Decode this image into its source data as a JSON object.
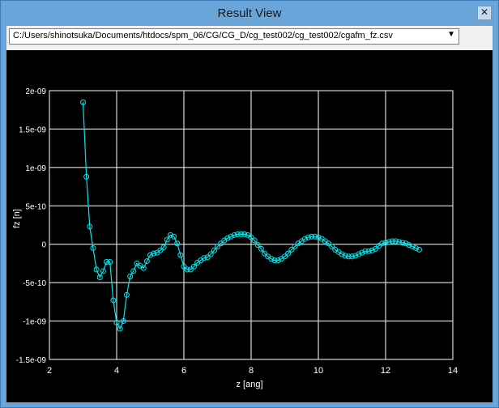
{
  "window": {
    "title": "Result View",
    "close_glyph": "✕"
  },
  "file_select": {
    "value": "C:/Users/shinotsuka/Documents/htdocs/spm_06/CG/CG_D/cg_test002/cg_test002/cgafm_fz.csv",
    "arrow_icon": "chevron-down-icon"
  },
  "colors": {
    "plot_bg": "#000000",
    "grid": "#ffffff",
    "series": "#00e5ee",
    "text": "#ffffff"
  },
  "chart_data": {
    "type": "line",
    "xlabel": "z [ang]",
    "ylabel": "fz [n]",
    "xlim": [
      2,
      14
    ],
    "ylim": [
      -1.5e-09,
      2e-09
    ],
    "xticks": [
      2,
      4,
      6,
      8,
      10,
      12,
      14
    ],
    "xtick_labels": [
      "2",
      "4",
      "6",
      "8",
      "10",
      "12",
      "14"
    ],
    "yticks": [
      2e-09,
      1.5e-09,
      1e-09,
      5e-10,
      0,
      -5e-10,
      -1e-09,
      -1.5e-09
    ],
    "ytick_labels": [
      "2e-09",
      "1.5e-09",
      "1e-09",
      "5e-10",
      "0",
      "-5e-10",
      "-1e-09",
      "-1.5e-09"
    ],
    "grid": true,
    "markers": "circle",
    "series": [
      {
        "x": [
          3.0,
          3.1,
          3.2,
          3.3,
          3.4,
          3.5,
          3.6,
          3.7,
          3.8,
          3.9,
          4.0,
          4.1,
          4.2,
          4.3,
          4.4,
          4.5,
          4.6,
          4.7,
          4.8,
          4.9,
          5.0,
          5.1,
          5.2,
          5.3,
          5.4,
          5.5,
          5.6,
          5.7,
          5.8,
          5.9,
          6.0,
          6.1,
          6.2,
          6.3,
          6.4,
          6.5,
          6.6,
          6.7,
          6.8,
          6.9,
          7.0,
          7.1,
          7.2,
          7.3,
          7.4,
          7.5,
          7.6,
          7.7,
          7.8,
          7.9,
          8.0,
          8.1,
          8.2,
          8.3,
          8.4,
          8.5,
          8.6,
          8.7,
          8.8,
          8.9,
          9.0,
          9.1,
          9.2,
          9.3,
          9.4,
          9.5,
          9.6,
          9.7,
          9.8,
          9.9,
          10.0,
          10.1,
          10.2,
          10.3,
          10.4,
          10.5,
          10.6,
          10.7,
          10.8,
          10.9,
          11.0,
          11.1,
          11.2,
          11.3,
          11.4,
          11.5,
          11.6,
          11.7,
          11.8,
          11.9,
          12.0,
          12.1,
          12.2,
          12.3,
          12.4,
          12.5,
          12.6,
          12.7,
          12.8,
          12.9,
          13.0
        ],
        "y": [
          1.85e-09,
          8.8e-10,
          2.3e-10,
          -5e-11,
          -3.3e-10,
          -4.3e-10,
          -3.5e-10,
          -2.3e-10,
          -2.3e-10,
          -7.3e-10,
          -1.02e-09,
          -1.1e-09,
          -1e-09,
          -6.6e-10,
          -4.2e-10,
          -3.5e-10,
          -2.5e-10,
          -2.8e-10,
          -3.1e-10,
          -2.2e-10,
          -1.4e-10,
          -1.2e-10,
          -1.1e-10,
          -8e-11,
          -4e-11,
          6e-11,
          1.2e-10,
          1e-10,
          1e-11,
          -1.4e-10,
          -2.9e-10,
          -3.3e-10,
          -3.3e-10,
          -2.9e-10,
          -2.4e-10,
          -2.1e-10,
          -1.8e-10,
          -1.7e-10,
          -1.3e-10,
          -8e-11,
          -3e-11,
          1e-11,
          5e-11,
          8e-11,
          1e-10,
          1.2e-10,
          1.3e-10,
          1.3e-10,
          1.3e-10,
          1.2e-10,
          9e-11,
          5e-11,
          -1e-11,
          -6e-11,
          -1.2e-10,
          -1.6e-10,
          -1.9e-10,
          -2.1e-10,
          -2.1e-10,
          -1.9e-10,
          -1.6e-10,
          -1.2e-10,
          -7e-11,
          -3e-11,
          1e-11,
          4e-11,
          7e-11,
          9e-11,
          1e-10,
          1e-10,
          9e-11,
          7e-11,
          4e-11,
          1e-11,
          -3e-11,
          -7e-11,
          -1e-10,
          -1.3e-10,
          -1.5e-10,
          -1.6e-10,
          -1.6e-10,
          -1.5e-10,
          -1.3e-10,
          -1.1e-10,
          -9e-11,
          -9e-11,
          -8e-11,
          -6e-11,
          -2e-11,
          1e-11,
          2e-11,
          3e-11,
          4e-11,
          4e-11,
          3e-11,
          2e-11,
          1e-11,
          -1e-11,
          -3e-11,
          -5e-11,
          -7e-11
        ]
      }
    ]
  }
}
